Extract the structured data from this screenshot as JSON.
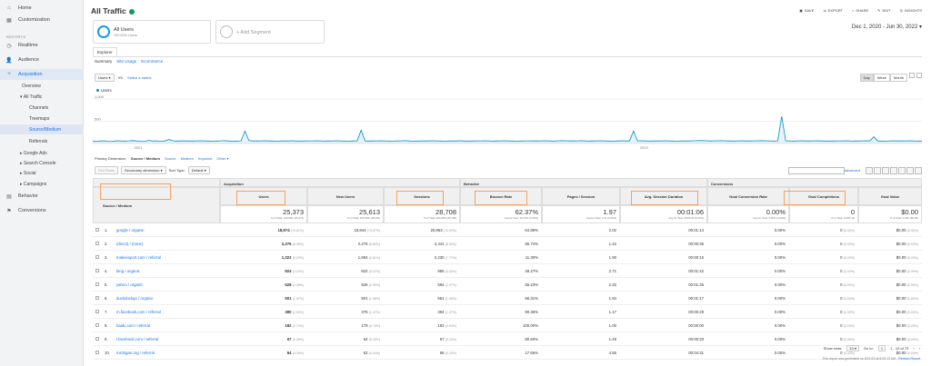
{
  "sidebar": {
    "top_items": [
      {
        "label": "Home",
        "icon": "home-icon",
        "glyph": "⌂"
      },
      {
        "label": "Customization",
        "icon": "customization-icon",
        "glyph": "▦"
      }
    ],
    "reports_label": "REPORTS",
    "items": [
      {
        "label": "Realtime",
        "icon": "clock-icon",
        "glyph": "◷"
      },
      {
        "label": "Audience",
        "icon": "person-icon",
        "glyph": "👤"
      },
      {
        "label": "Acquisition",
        "icon": "acquisition-icon",
        "glyph": "⑂"
      }
    ],
    "acq_children": [
      "Overview",
      "All Traffic"
    ],
    "all_traffic_children": [
      "Channels",
      "Treemaps",
      "Source/Medium",
      "Referrals"
    ],
    "more_acq": [
      "Google Ads",
      "Search Console",
      "Social",
      "Campaigns"
    ],
    "bottom_items": [
      {
        "label": "Behavior",
        "icon": "behavior-icon",
        "glyph": "▤"
      },
      {
        "label": "Conversions",
        "icon": "flag-icon",
        "glyph": "⚑"
      }
    ]
  },
  "header": {
    "title": "All Traffic",
    "toolbar": [
      "SAVE",
      "EXPORT",
      "SHARE",
      "EDIT",
      "INSIGHTS"
    ],
    "date_range": "Dec 1, 2020 - Jun 30, 2022"
  },
  "segments": {
    "active_name": "All Users",
    "active_sub": "100.00% Users",
    "add_label": "+ Add Segment"
  },
  "tabs": {
    "explorer": "Explorer",
    "sub": [
      "Summary",
      "Site Usage",
      "Ecommerce"
    ]
  },
  "chart_controls": {
    "metric": "Users",
    "vs": "VS.",
    "select_metric": "Select a metric",
    "periods": [
      "Day",
      "Week",
      "Month"
    ]
  },
  "chart_data": {
    "type": "line",
    "series": [
      {
        "name": "Users"
      }
    ],
    "y_ticks": [
      "1,000",
      "500"
    ],
    "x_ticks": [
      "2021",
      "2022"
    ],
    "values": [
      55,
      50,
      58,
      60,
      52,
      48,
      62,
      57,
      55,
      60,
      65,
      58,
      54,
      50,
      70,
      55,
      60,
      52,
      58,
      90,
      62,
      55,
      58,
      60,
      57,
      55,
      60,
      62,
      58,
      56,
      54,
      58,
      60,
      63,
      57,
      52,
      55,
      60,
      280,
      65,
      58,
      57,
      60,
      62,
      58,
      55,
      53,
      57,
      60,
      58,
      62,
      56,
      55,
      57,
      59,
      60,
      61,
      57,
      55,
      58,
      60,
      62,
      58,
      56,
      54,
      58,
      60,
      300,
      58,
      55,
      57,
      60,
      62,
      58,
      56,
      54,
      58,
      60,
      63,
      57,
      52,
      55,
      60,
      58,
      57,
      62,
      58,
      55,
      53,
      57,
      60,
      58,
      62,
      56,
      55,
      57,
      59,
      60,
      61,
      57,
      55,
      58,
      60,
      62,
      58,
      56,
      54,
      58,
      60,
      59,
      57,
      58,
      60,
      62,
      58,
      56,
      60,
      64,
      62,
      58,
      57,
      60,
      63,
      57,
      55,
      58,
      60,
      62,
      58,
      56,
      54,
      58,
      62,
      58,
      57,
      280,
      60,
      62,
      58,
      56,
      60,
      58,
      57,
      62,
      58,
      55,
      53,
      57,
      60,
      58,
      62,
      64,
      66,
      62,
      58,
      60,
      62,
      64,
      60,
      58,
      56,
      60,
      62,
      58,
      57,
      60,
      62,
      64,
      62,
      58,
      56,
      60,
      610,
      62,
      58,
      56,
      60,
      62,
      58,
      57,
      60,
      62,
      58,
      56,
      55,
      57,
      59,
      60,
      61,
      57,
      55,
      58,
      60,
      62,
      58,
      150,
      58,
      56,
      54,
      60,
      62,
      58,
      57,
      60,
      62,
      58,
      56,
      55
    ],
    "ylim": [
      0,
      1000
    ]
  },
  "dimensions": {
    "label": "Primary Dimension:",
    "options": [
      "Source / Medium",
      "Source",
      "Medium",
      "Keyword",
      "Other"
    ],
    "plot_rows": "Plot Rows",
    "secondary": "Secondary dimension",
    "sort_type": "Sort Type:",
    "sort_default": "Default",
    "advanced": "advanced"
  },
  "table": {
    "groups": [
      "Acquisition",
      "Behavior",
      "Conversions"
    ],
    "headers": [
      "Source / Medium",
      "Users",
      "New Users",
      "Sessions",
      "Bounce Rate",
      "Pages / Session",
      "Avg. Session Duration",
      "Goal Conversion Rate",
      "Goal Completions",
      "Goal Value"
    ],
    "totals": [
      {
        "v": "25,373",
        "s": "% of Total: 100.00% (25,373)"
      },
      {
        "v": "25,613",
        "s": "% of Total: 100.05% (25,600)"
      },
      {
        "v": "28,708",
        "s": "% of Total: 100.00% (28,708)"
      },
      {
        "v": "62.37%",
        "s": "Avg for View: 62.37% (0.00%)"
      },
      {
        "v": "1.97",
        "s": "Avg for View: 1.97 (0.00%)"
      },
      {
        "v": "00:01:06",
        "s": "Avg for View: 00:01:06 (0.00%)"
      },
      {
        "v": "0.00%",
        "s": "Avg for View: 0.00% (0.00%)"
      },
      {
        "v": "0",
        "s": "% of Total: 0.00% (0)"
      },
      {
        "v": "$0.00",
        "s": "% of Total: 0.00% ($0.00)"
      }
    ],
    "rows": [
      {
        "n": "1.",
        "src": "google / organic",
        "u": "18,974",
        "up": "(74.61%)",
        "nu": "18,844",
        "nup": "(73.57%)",
        "s": "20,963",
        "sp": "(73.02%)",
        "br": "64.89%",
        "ps": "2.02",
        "d": "00:01:14",
        "cr": "0.00%",
        "gc": "0",
        "gcp": "(0.00%)",
        "gv": "$0.00",
        "gvp": "(0.00%)"
      },
      {
        "n": "2.",
        "src": "(direct) / (none)",
        "u": "2,276",
        "up": "(8.95%)",
        "nu": "2,276",
        "nup": "(8.89%)",
        "s": "2,441",
        "sp": "(8.50%)",
        "br": "85.74%",
        "ps": "1.42",
        "d": "00:00:35",
        "cr": "0.00%",
        "gc": "0",
        "gcp": "(0.00%)",
        "gv": "$0.00",
        "gvp": "(0.00%)"
      },
      {
        "n": "3.",
        "src": "makeexport.com / referral",
        "u": "1,322",
        "up": "(5.20%)",
        "nu": "1,694",
        "nup": "(6.61%)",
        "s": "2,230",
        "sp": "(7.77%)",
        "br": "11.30%",
        "ps": "1.90",
        "d": "00:00:15",
        "cr": "0.00%",
        "gc": "0",
        "gcp": "(0.00%)",
        "gv": "$0.00",
        "gvp": "(0.00%)"
      },
      {
        "n": "4.",
        "src": "bing / organic",
        "u": "824",
        "up": "(3.24%)",
        "nu": "822",
        "nup": "(3.21%)",
        "s": "985",
        "sp": "(3.43%)",
        "br": "48.27%",
        "ps": "2.71",
        "d": "00:01:42",
        "cr": "0.00%",
        "gc": "0",
        "gcp": "(0.00%)",
        "gv": "$0.00",
        "gvp": "(0.00%)"
      },
      {
        "n": "5.",
        "src": "yahoo / organic",
        "u": "528",
        "up": "(2.08%)",
        "nu": "526",
        "nup": "(2.05%)",
        "s": "594",
        "sp": "(2.07%)",
        "br": "56.23%",
        "ps": "2.32",
        "d": "00:01:35",
        "cr": "0.00%",
        "gc": "0",
        "gcp": "(0.00%)",
        "gv": "$0.00",
        "gvp": "(0.00%)"
      },
      {
        "n": "6.",
        "src": "duckduckgo / organic",
        "u": "501",
        "up": "(1.97%)",
        "nu": "501",
        "nup": "(1.96%)",
        "s": "561",
        "sp": "(1.95%)",
        "br": "66.31%",
        "ps": "1.94",
        "d": "00:01:17",
        "cr": "0.00%",
        "gc": "0",
        "gcp": "(0.00%)",
        "gv": "$0.00",
        "gvp": "(0.00%)"
      },
      {
        "n": "7.",
        "src": "m.facebook.com / referral",
        "u": "380",
        "up": "(1.50%)",
        "nu": "376",
        "nup": "(1.47%)",
        "s": "394",
        "sp": "(1.37%)",
        "br": "90.36%",
        "ps": "1.17",
        "d": "00:00:29",
        "cr": "0.00%",
        "gc": "0",
        "gcp": "(0.00%)",
        "gv": "$0.00",
        "gvp": "(0.00%)"
      },
      {
        "n": "8.",
        "src": "baidu.com / referral",
        "u": "182",
        "up": "(0.72%)",
        "nu": "179",
        "nup": "(0.70%)",
        "s": "182",
        "sp": "(0.63%)",
        "br": "100.00%",
        "ps": "1.00",
        "d": "00:00:00",
        "cr": "0.00%",
        "gc": "0",
        "gcp": "(0.00%)",
        "gv": "$0.00",
        "gvp": "(0.00%)"
      },
      {
        "n": "9.",
        "src": "l.facebook.com / referral",
        "u": "67",
        "up": "(0.26%)",
        "nu": "64",
        "nup": "(0.25%)",
        "s": "67",
        "sp": "(0.23%)",
        "br": "80.60%",
        "ps": "1.49",
        "d": "00:00:33",
        "cr": "0.00%",
        "gc": "0",
        "gcp": "(0.00%)",
        "gv": "$0.00",
        "gvp": "(0.00%)"
      },
      {
        "n": "10.",
        "src": "michigan.org / referral",
        "u": "64",
        "up": "(0.25%)",
        "nu": "62",
        "nup": "(0.24%)",
        "s": "66",
        "sp": "(0.23%)",
        "br": "17.65%",
        "ps": "4.56",
        "d": "00:04:31",
        "cr": "0.00%",
        "gc": "0",
        "gcp": "(0.00%)",
        "gv": "$0.00",
        "gvp": "(0.00%)"
      }
    ]
  },
  "footer": {
    "show_rows": "Show rows:",
    "rows_value": "10",
    "goto": "Go to:",
    "goto_value": "1",
    "range": "1 - 10 of 73",
    "report_note": "This report was generated on 6/21/24 at 6:00:13 AM -",
    "refresh": "Refresh Report"
  }
}
